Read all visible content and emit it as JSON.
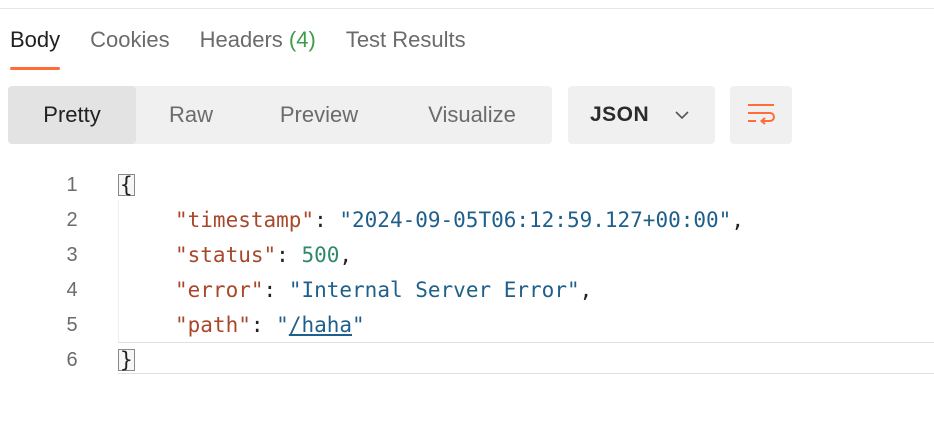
{
  "tabs": [
    {
      "label": "Body",
      "active": true
    },
    {
      "label": "Cookies"
    },
    {
      "label": "Headers",
      "count": "(4)"
    },
    {
      "label": "Test Results"
    }
  ],
  "view_modes": [
    "Pretty",
    "Raw",
    "Preview",
    "Visualize"
  ],
  "active_view": "Pretty",
  "format": "JSON",
  "icons": {
    "format_dropdown": "chevron-down-icon",
    "wrap": "wrap-lines-icon"
  },
  "colors": {
    "accent": "#ff6c37",
    "count_green": "#3c9d4b",
    "json_key": "#a9472b",
    "json_string": "#1f5f8b",
    "json_number": "#31896a"
  },
  "response": {
    "line_numbers": [
      "1",
      "2",
      "3",
      "4",
      "5",
      "6"
    ],
    "open_brace": "{",
    "close_brace": "}",
    "fields": [
      {
        "key": "\"timestamp\"",
        "value": "\"2024-09-05T06:12:59.127+00:00\"",
        "type": "string",
        "comma": ","
      },
      {
        "key": "\"status\"",
        "value": "500",
        "type": "number",
        "comma": ","
      },
      {
        "key": "\"error\"",
        "value": "\"Internal Server Error\"",
        "type": "string",
        "comma": ","
      },
      {
        "key": "\"path\"",
        "value": "/haha",
        "type": "link",
        "comma": ""
      }
    ]
  }
}
